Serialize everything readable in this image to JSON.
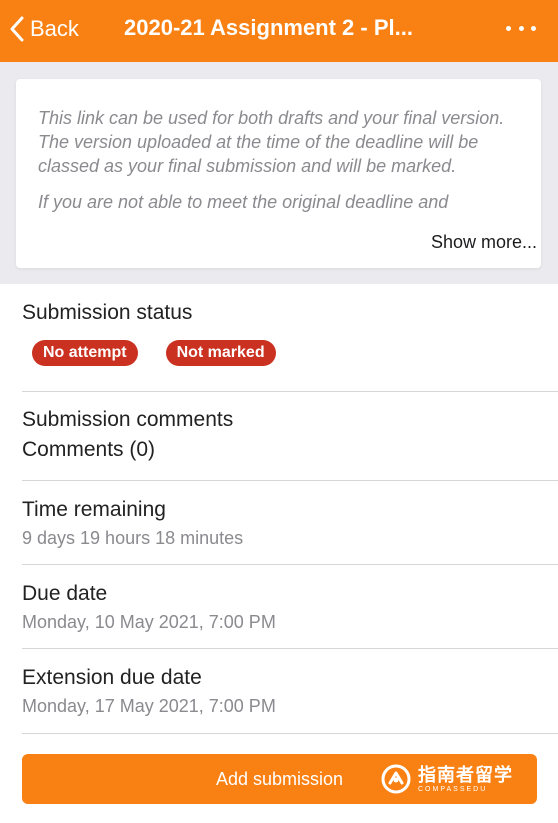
{
  "header": {
    "back_label": "Back",
    "title": "2020-21 Assignment 2 - Pl...",
    "background_color": "#f98012"
  },
  "intro": {
    "paragraph_1": "This link can be used for both drafts and your final version.  The version uploaded at the time of the deadline will be classed as your final submission and will be marked.",
    "paragraph_2_partial": "If you are not able to meet the original deadline and",
    "show_more_label": "Show more..."
  },
  "submission_status": {
    "title": "Submission status",
    "badges": [
      "No attempt",
      "Not marked"
    ],
    "badge_color": "#ca3120"
  },
  "submission_comments": {
    "title": "Submission comments",
    "value": "Comments (0)"
  },
  "time_remaining": {
    "title": "Time remaining",
    "value": "9 days 19 hours 18 minutes"
  },
  "due_date": {
    "title": "Due date",
    "value": "Monday, 10 May 2021, 7:00 PM"
  },
  "extension_due_date": {
    "title": "Extension due date",
    "value": "Monday, 17 May 2021, 7:00 PM"
  },
  "actions": {
    "add_submission_label": "Add submission"
  },
  "watermark": {
    "logo": "compassedu-logo-icon",
    "text_cn": "指南者留学",
    "text_en": "COMPASSEDU"
  }
}
